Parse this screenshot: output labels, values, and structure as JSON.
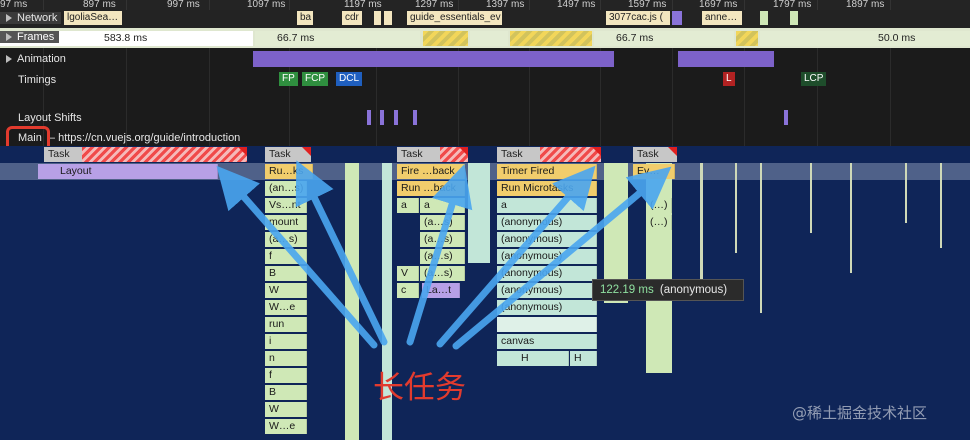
{
  "ruler": {
    "ticks": [
      "97 ms",
      "897 ms",
      "997 ms",
      "1097 ms",
      "1197 ms",
      "1297 ms",
      "1397 ms",
      "1497 ms",
      "1597 ms",
      "1697 ms",
      "1797 ms",
      "1897 ms"
    ]
  },
  "rows": {
    "network": "Network",
    "frames": "Frames",
    "animation": "Animation",
    "timings": "Timings",
    "layout_shifts": "Layout Shifts",
    "main": "Main",
    "main_url": "– https://cn.vuejs.org/guide/introduction"
  },
  "network_items": [
    "lgoliaSea…",
    "ba",
    "cdr",
    "guide_essentials_ev…",
    "3077cac.js (",
    "anne…"
  ],
  "frames": [
    "583.8 ms",
    "66.7 ms",
    "66.7 ms",
    "50.0 ms"
  ],
  "timings": {
    "fp": "FP",
    "fcp": "FCP",
    "dcl": "DCL",
    "l": "L",
    "lcp": "LCP"
  },
  "flame": {
    "task": "Task",
    "layout": "Layout",
    "g1": [
      "Ru…ks",
      "(an…s)",
      "Vs…nt",
      "mount",
      "(a…s)",
      "f",
      "B",
      "W",
      "W…e",
      "run",
      "i",
      "n",
      "f",
      "B",
      "W",
      "W…e"
    ],
    "g2a": [
      "Fire …back",
      "a",
      "(a…s)",
      "(a…s)",
      "V",
      "c"
    ],
    "g2b": [
      "Run …back",
      "a",
      "(a…s)",
      "(a…s)",
      "(a…s)",
      "La…t"
    ],
    "g3": [
      "Timer Fired",
      "Run Microtasks",
      "a",
      "(anonymous)",
      "(anonymous)",
      "(anonymous)",
      "(anonymous)",
      "(anonymous)",
      "(anonymous)",
      "canvas"
    ],
    "g3h": [
      "H",
      "H"
    ],
    "g4": [
      "Ev…",
      "(…)",
      "(…)"
    ]
  },
  "tooltip": {
    "time": "122.19 ms",
    "name": "(anonymous)"
  },
  "annotation": "长任务",
  "watermark": "@稀土掘金技术社区"
}
